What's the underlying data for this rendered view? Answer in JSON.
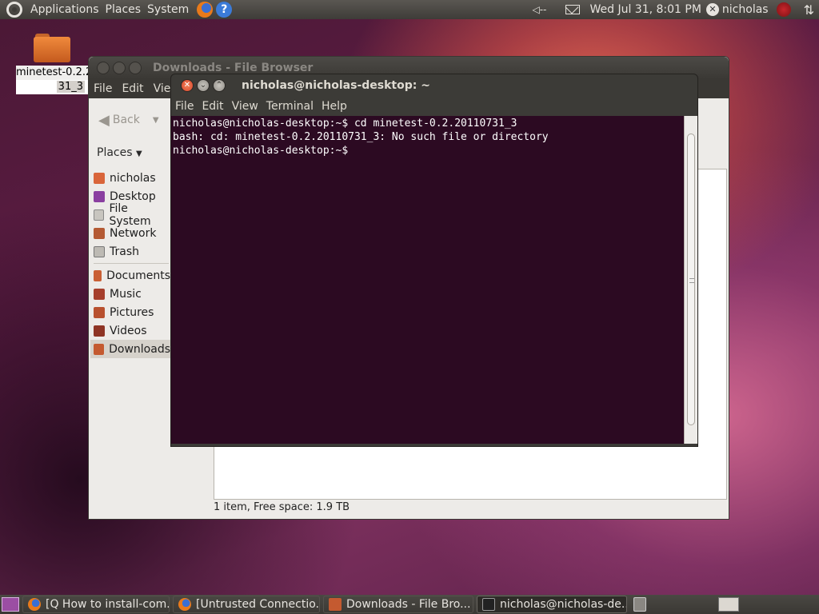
{
  "top_panel": {
    "menus": [
      "Applications",
      "Places",
      "System"
    ],
    "datetime": "Wed Jul 31,  8:01 PM",
    "user": "nicholas",
    "icons": [
      "ubuntu-logo-icon",
      "firefox-icon",
      "help-icon",
      "volume-icon",
      "mail-icon",
      "user-status-icon",
      "shutdown-icon",
      "network-icon"
    ]
  },
  "desktop_icon": {
    "label_line1": "minetest-0.2.2",
    "label_line2": "31_3",
    "icon": "folder-icon"
  },
  "file_browser": {
    "title": "Downloads - File Browser",
    "menus": [
      "File",
      "Edit",
      "View"
    ],
    "back_label": "Back",
    "places_header": "Places",
    "places": [
      "nicholas",
      "Desktop",
      "File System",
      "Network",
      "Trash"
    ],
    "bookmarks": [
      "Documents",
      "Music",
      "Pictures",
      "Videos",
      "Downloads"
    ],
    "selected": "Downloads",
    "status": "1 item, Free space: 1.9 TB"
  },
  "terminal": {
    "title": "nicholas@nicholas-desktop: ~",
    "menus": [
      "File",
      "Edit",
      "View",
      "Terminal",
      "Help"
    ],
    "lines": [
      "nicholas@nicholas-desktop:~$ cd minetest-0.2.20110731_3",
      "bash: cd: minetest-0.2.20110731_3: No such file or directory",
      "nicholas@nicholas-desktop:~$ "
    ]
  },
  "taskbar": {
    "tasks": [
      {
        "label": "[Q How to install-com...",
        "icon": "firefox-icon"
      },
      {
        "label": "[Untrusted Connectio...",
        "icon": "firefox-icon"
      },
      {
        "label": "Downloads - File Bro...",
        "icon": "folder-icon"
      },
      {
        "label": "nicholas@nicholas-de...",
        "icon": "terminal-icon"
      }
    ]
  },
  "colors": {
    "terminal_bg": "#2c0a22",
    "panel_bg": "#3c3b37",
    "accent_orange": "#f08a3c"
  }
}
